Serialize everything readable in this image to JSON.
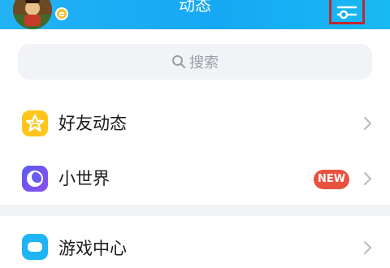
{
  "header": {
    "title": "动态",
    "avatar": "user-avatar",
    "settings_icon": "sliders-icon",
    "background": "#1eaef5"
  },
  "search": {
    "placeholder": "搜索",
    "icon": "search-icon"
  },
  "list": {
    "items": [
      {
        "label": "好友动态",
        "icon": "friend-feed-icon",
        "icon_color": "#ffc51a"
      },
      {
        "label": "小世界",
        "icon": "small-world-icon",
        "icon_color": "#5b5cf0",
        "badge": "NEW",
        "badge_color": "#e9523e"
      },
      {
        "label": "游戏中心",
        "icon": "game-center-icon",
        "icon_color": "#1fb4f4"
      }
    ]
  }
}
